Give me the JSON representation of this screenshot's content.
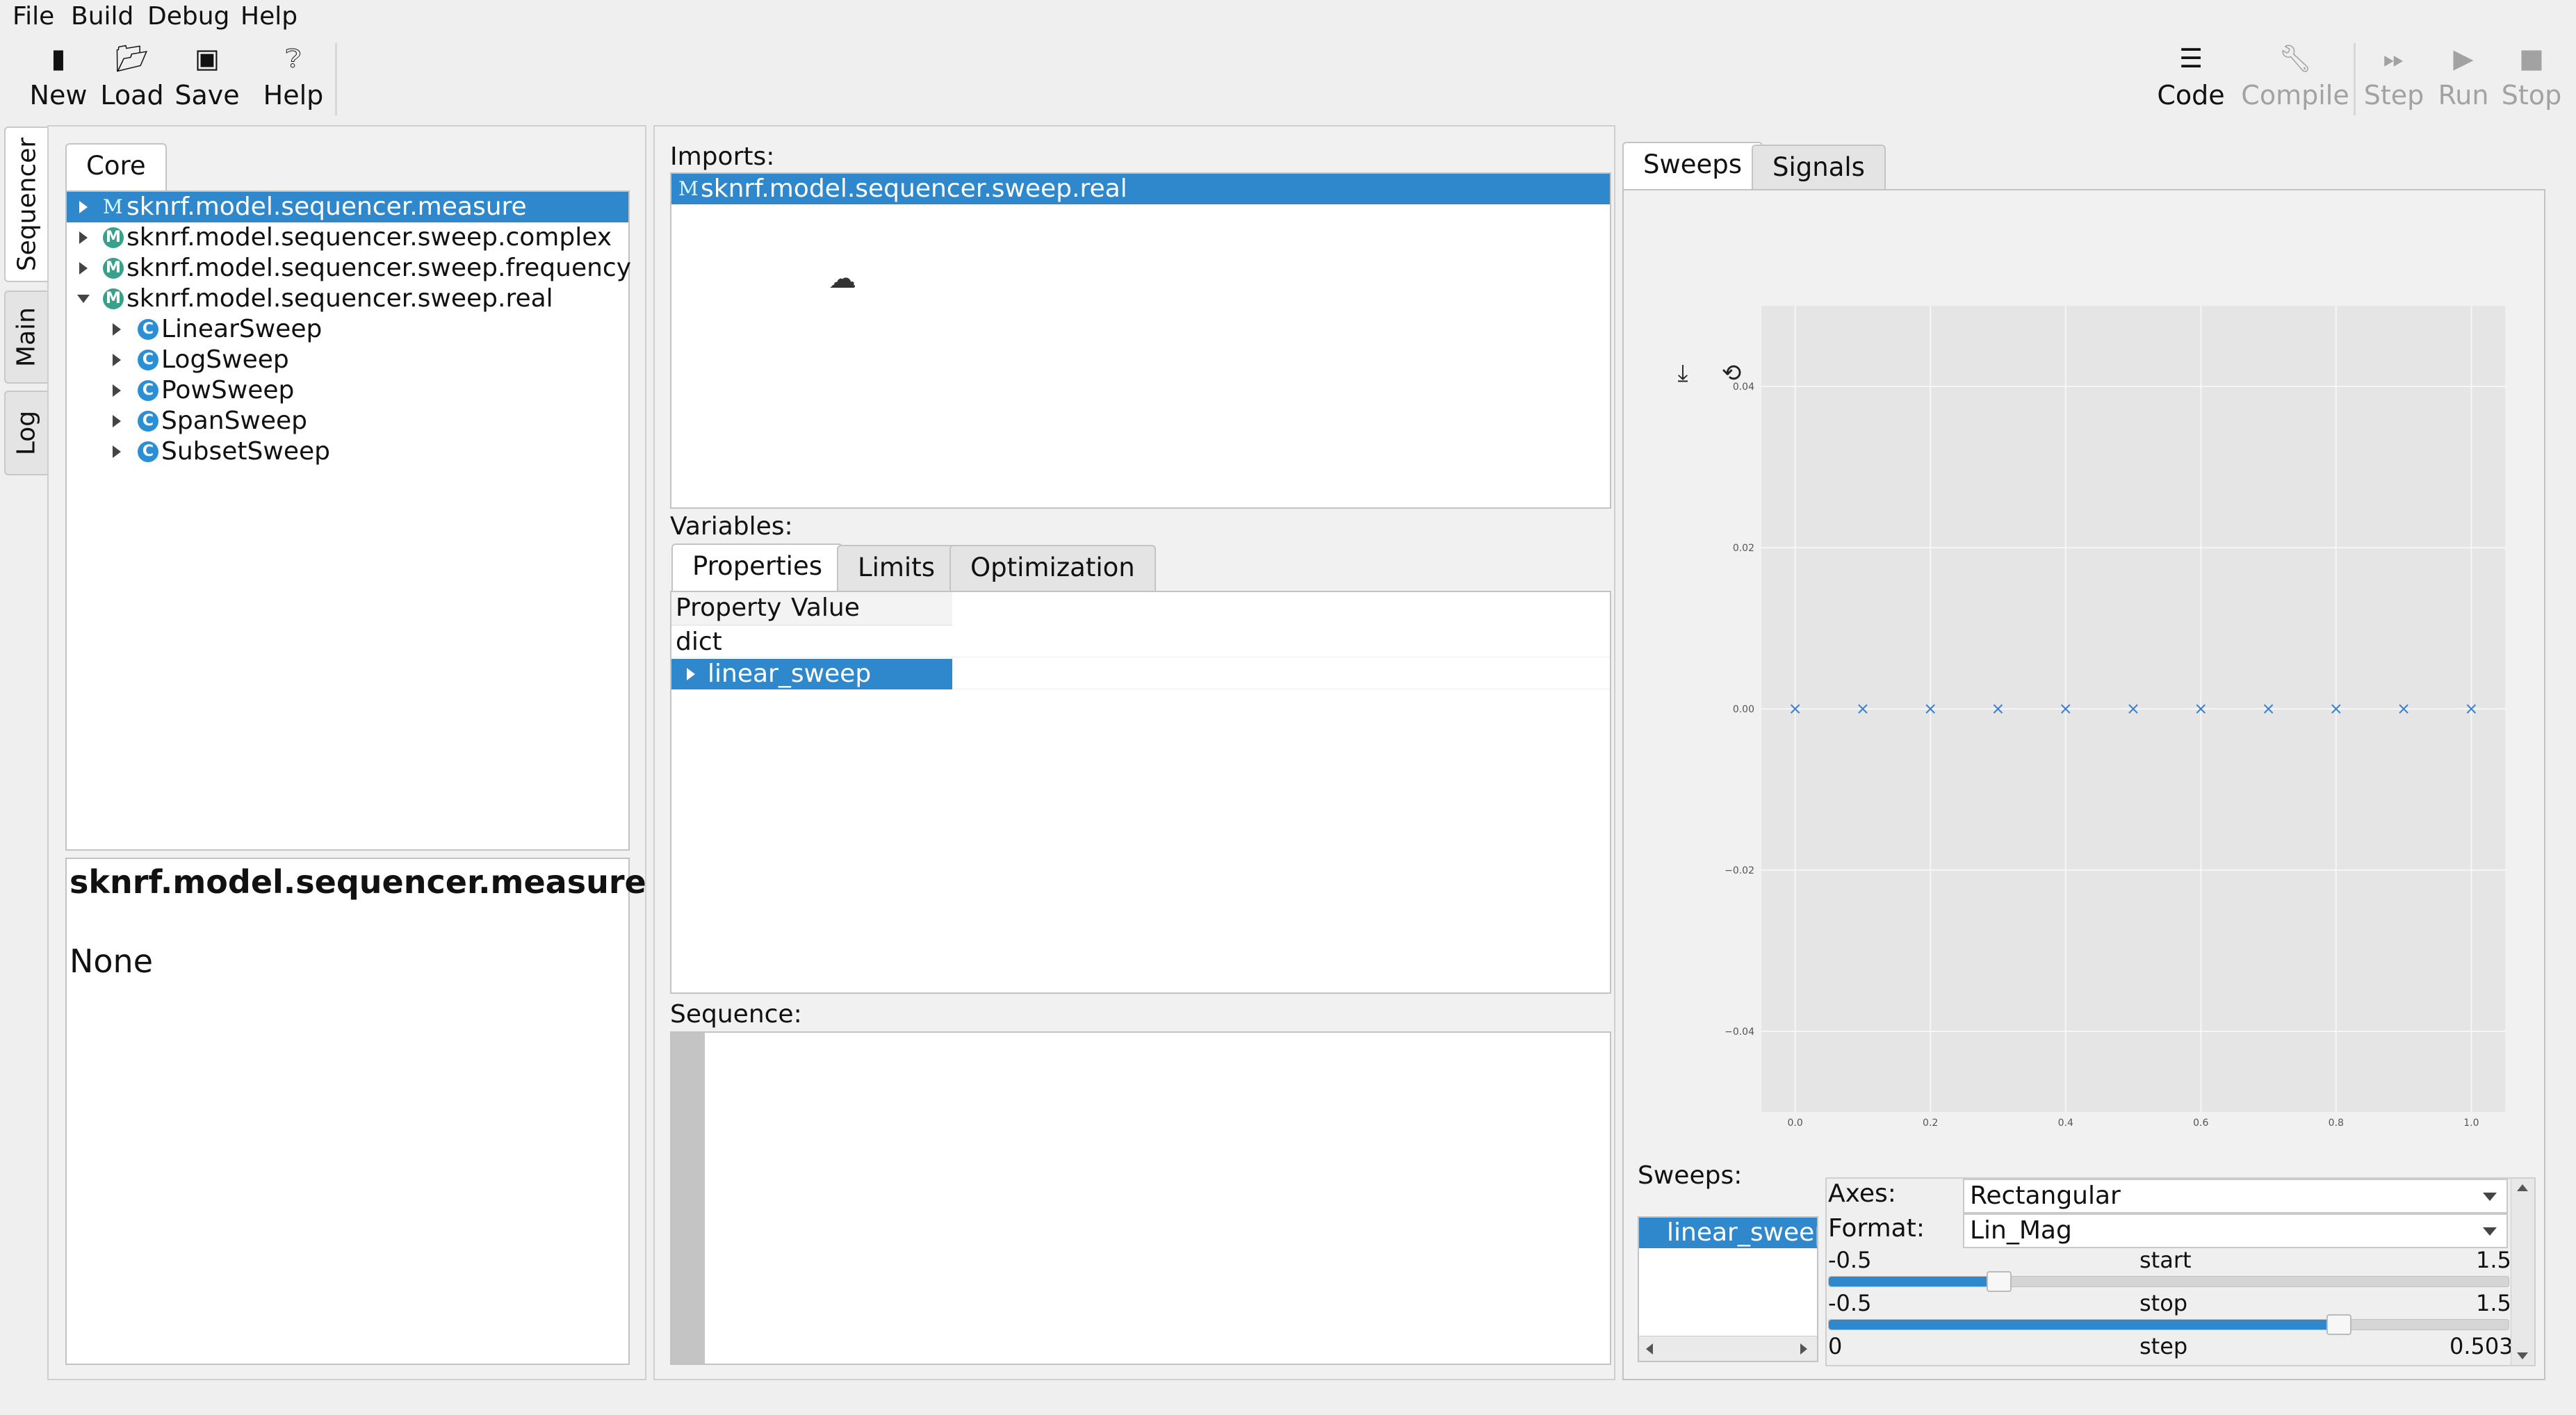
{
  "menu": [
    "File",
    "Build",
    "Debug",
    "Help"
  ],
  "toolbar": {
    "new": "New",
    "load": "Load",
    "save": "Save",
    "help": "Help",
    "code": "Code",
    "compile": "Compile",
    "step": "Step",
    "run": "Run",
    "stop": "Stop"
  },
  "side_tabs": [
    "Sequencer",
    "Main",
    "Log"
  ],
  "left": {
    "tab": "Core",
    "tree": [
      {
        "label": "sknrf.model.sequencer.measure",
        "kind": "module",
        "expanded": false,
        "selected": true
      },
      {
        "label": "sknrf.model.sequencer.sweep.complex",
        "kind": "package",
        "expanded": false
      },
      {
        "label": "sknrf.model.sequencer.sweep.frequency",
        "kind": "package",
        "expanded": false
      },
      {
        "label": "sknrf.model.sequencer.sweep.real",
        "kind": "package",
        "expanded": true,
        "children": [
          "LinearSweep",
          "LogSweep",
          "PowSweep",
          "SpanSweep",
          "SubsetSweep"
        ]
      }
    ],
    "doc_title": "sknrf.model.sequencer.measure",
    "doc_body": "None"
  },
  "middle": {
    "imports_label": "Imports:",
    "imports": [
      "sknrf.model.sequencer.sweep.real"
    ],
    "variables_label": "Variables:",
    "var_tabs": [
      "Properties",
      "Limits",
      "Optimization"
    ],
    "columns": [
      "Property",
      "Value"
    ],
    "rows": [
      {
        "property": "dict"
      },
      {
        "property": "linear_sweep",
        "selected": true
      }
    ],
    "sequence_label": "Sequence:"
  },
  "right": {
    "tabs": [
      "Sweeps",
      "Signals"
    ],
    "plot_tools": [
      "download-icon",
      "undo-icon",
      "redo-icon",
      "zoom-in-icon",
      "zoom-out-icon",
      "zoom-fit-icon",
      "eye-icon",
      "pin-icon",
      "close-icon"
    ],
    "y_ticks": [
      "0.04",
      "0.02",
      "0.00",
      "−0.02",
      "−0.04"
    ],
    "x_ticks": [
      "0.0",
      "0.2",
      "0.4",
      "0.6",
      "0.8",
      "1.0"
    ],
    "sweeps_label": "Sweeps:",
    "sweeps": [
      "linear_sweep"
    ],
    "axes_label": "Axes:",
    "axes_value": "Rectangular",
    "format_label": "Format:",
    "format_value": "Lin_Mag",
    "sliders": [
      {
        "name": "start",
        "min": "-0.5",
        "max": "1.5",
        "value": 0.0
      },
      {
        "name": "stop",
        "min": "-0.5",
        "max": "1.5",
        "value": 1.0
      },
      {
        "name": "step",
        "min": "0",
        "max": "0.503",
        "value": null
      }
    ]
  },
  "chart_data": {
    "type": "scatter",
    "x": [
      0.0,
      0.1,
      0.2,
      0.3,
      0.4,
      0.5,
      0.6,
      0.7,
      0.8,
      0.9,
      1.0
    ],
    "y": [
      0,
      0,
      0,
      0,
      0,
      0,
      0,
      0,
      0,
      0,
      0
    ],
    "xlim": [
      -0.05,
      1.05
    ],
    "ylim": [
      -0.05,
      0.05
    ],
    "marker": "x",
    "grid": true,
    "color": "#3a7fd0"
  }
}
